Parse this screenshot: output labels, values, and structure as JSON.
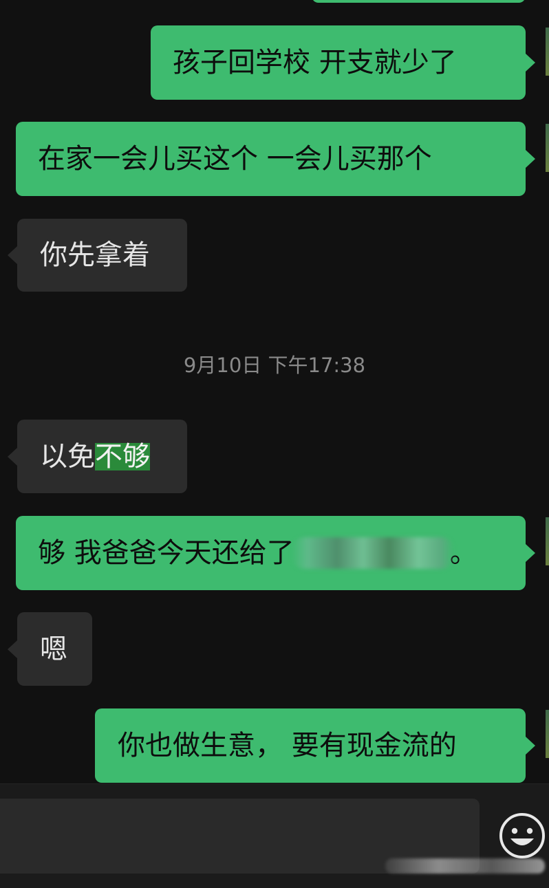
{
  "chat": {
    "timestamp": "9月10日 下午17:38",
    "messages": [
      {
        "side": "out",
        "text": "孩子回学校  开支就少了"
      },
      {
        "side": "out",
        "text": "在家一会儿买这个  一会儿买那个"
      },
      {
        "side": "in",
        "text": "你先拿着"
      },
      {
        "side": "in",
        "text_plain": "以免",
        "text_highlighted": "不够"
      },
      {
        "side": "out",
        "text_before": "够  我爸爸今天还给了",
        "text_after": "。"
      },
      {
        "side": "in",
        "text": "嗯"
      },
      {
        "side": "out",
        "text": "你也做生意，  要有现金流的"
      }
    ]
  },
  "input_bar": {
    "emoji_icon": "smiley-face-icon"
  },
  "colors": {
    "background": "#111111",
    "outgoing_bubble": "#3ebb6f",
    "incoming_bubble": "#2c2c2c",
    "highlight": "#2a8a3a",
    "timestamp_text": "#8a8a8a"
  }
}
